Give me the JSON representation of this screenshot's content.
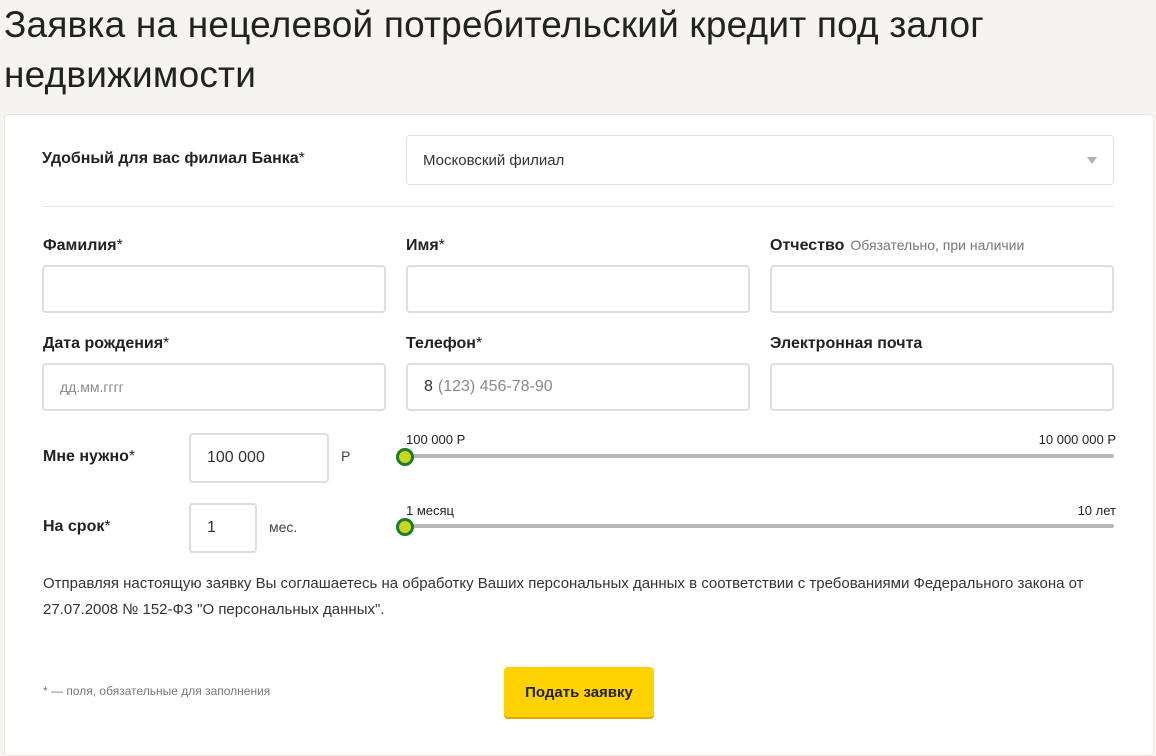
{
  "page": {
    "title": "Заявка на нецелевой потребительский кредит под залог недвижимости"
  },
  "form": {
    "branch": {
      "label": "Удобный для вас филиал Банка",
      "required_mark": "*",
      "value": "Московский филиал"
    },
    "surname": {
      "label": "Фамилия",
      "required_mark": "*",
      "value": "",
      "placeholder": ""
    },
    "name": {
      "label": "Имя",
      "required_mark": "*",
      "value": "",
      "placeholder": ""
    },
    "patronymic": {
      "label": "Отчество",
      "hint": "Обязательно, при наличии",
      "value": "",
      "placeholder": ""
    },
    "birthdate": {
      "label": "Дата рождения",
      "required_mark": "*",
      "value": "",
      "placeholder": "дд.мм.гггг"
    },
    "phone": {
      "label": "Телефон",
      "required_mark": "*",
      "value": "8",
      "placeholder": "(123) 456-78-90"
    },
    "email": {
      "label": "Электронная почта",
      "value": "",
      "placeholder": ""
    },
    "amount": {
      "label": "Мне нужно",
      "required_mark": "*",
      "value": "100 000",
      "unit": "Р",
      "slider_min_label": "100 000 Р",
      "slider_max_label": "10 000 000 Р",
      "slider_position": 0
    },
    "term": {
      "label": "На срок",
      "required_mark": "*",
      "value": "1",
      "unit": "мес.",
      "slider_min_label": "1 месяц",
      "slider_max_label": "10 лет",
      "slider_position": 0
    },
    "consent_text": "Отправляя настоящую заявку Вы соглашаетесь на обработку Ваших персональных данных в соответствии с требованиями Федерального закона от 27.07.2008 № 152-ФЗ \"О персональных данных\".",
    "footnote": "* — поля, обязательные для заполнения",
    "submit_label": "Подать заявку"
  },
  "icons": {
    "dropdown": "chevron-down-icon",
    "slider_thumb": "slider-thumb"
  },
  "colors": {
    "submit_bg": "#ffd200",
    "thumb_fill": "#c9d81e",
    "thumb_border": "#1f7a2e",
    "page_bg": "#f5f4f0"
  }
}
